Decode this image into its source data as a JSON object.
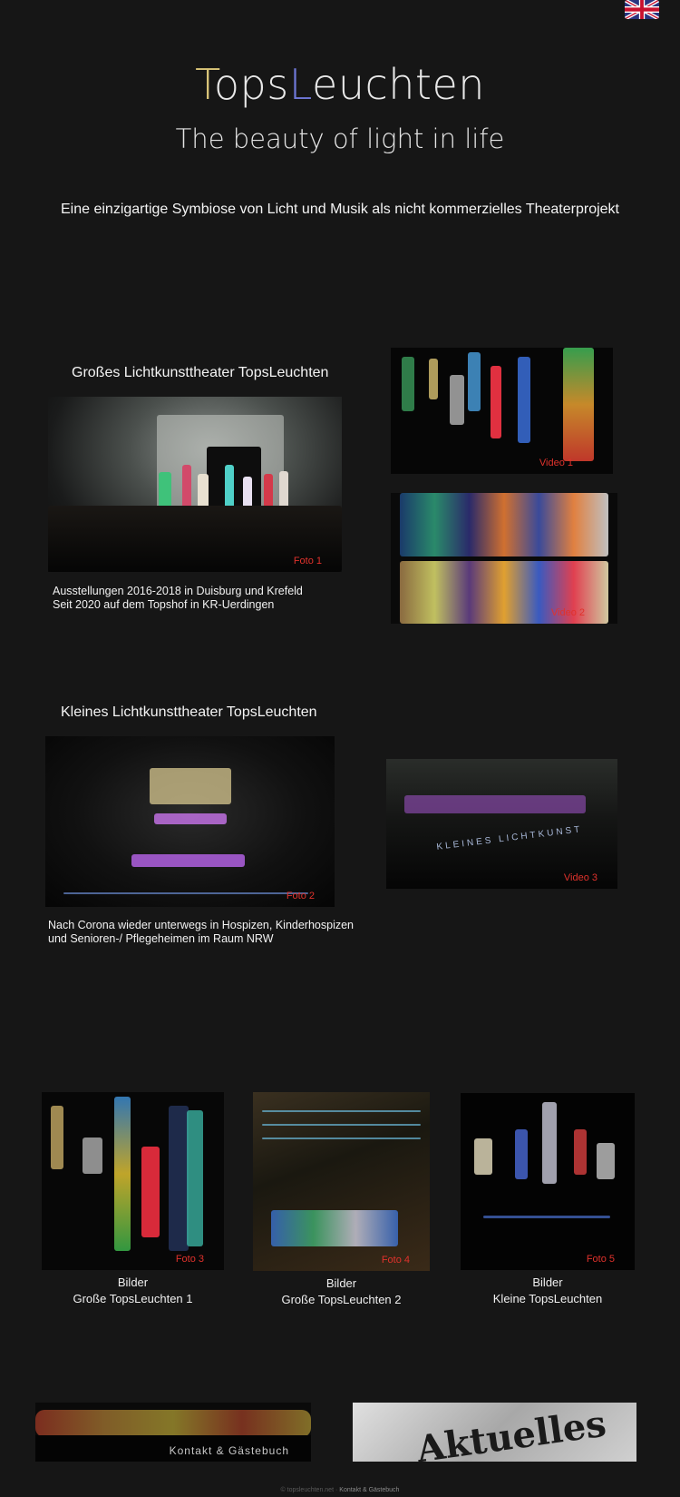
{
  "header": {
    "logo_t": "T",
    "logo_ops": "ops",
    "logo_l": "L",
    "logo_euchten": "euchten",
    "tagline": "The beauty of light in life",
    "intro": "Eine einzigartige Symbiose von Licht und Musik als nicht kommerzielles Theaterprojekt"
  },
  "language_flag": "uk-flag-icon",
  "section1": {
    "title": "Großes Lichtkunsttheater TopsLeuchten",
    "photo_tag": "Foto 1",
    "caption_line1": "Ausstellungen 2016-2018 in Duisburg und Krefeld",
    "caption_line2": "Seit 2020 auf dem Topshof in KR-Uerdingen",
    "video1_tag": "Video 1",
    "video2_tag": "Video 2"
  },
  "section2": {
    "title": "Kleines Lichtkunsttheater TopsLeuchten",
    "photo_tag": "Foto 2",
    "caption_line1": "Nach Corona wieder unterwegs in Hospizen, Kinderhospizen",
    "caption_line2": "und Senioren-/ Pflegeheimen im Raum NRW",
    "video3_tag": "Video 3",
    "video3_overlay": "KLEINES LICHTKUNST"
  },
  "gallery": [
    {
      "tag": "Foto 3",
      "line1": "Bilder",
      "line2": "Große TopsLeuchten 1"
    },
    {
      "tag": "Foto 4",
      "line1": "Bilder",
      "line2": "Große TopsLeuchten 2"
    },
    {
      "tag": "Foto 5",
      "line1": "Bilder",
      "line2": "Kleine TopsLeuchten"
    }
  ],
  "banners": {
    "contact_label": "Kontakt & Gästebuch",
    "news_label": "Aktuelles"
  },
  "footer": {
    "copyright": "© topsleuchten.net",
    "separator": "·",
    "contact_link": "Kontakt & Gästebuch"
  },
  "colors": {
    "background": "#161616",
    "photo_tag": "#e0322c",
    "logo_t": "#dcc77a",
    "logo_l": "#6f78d8"
  }
}
